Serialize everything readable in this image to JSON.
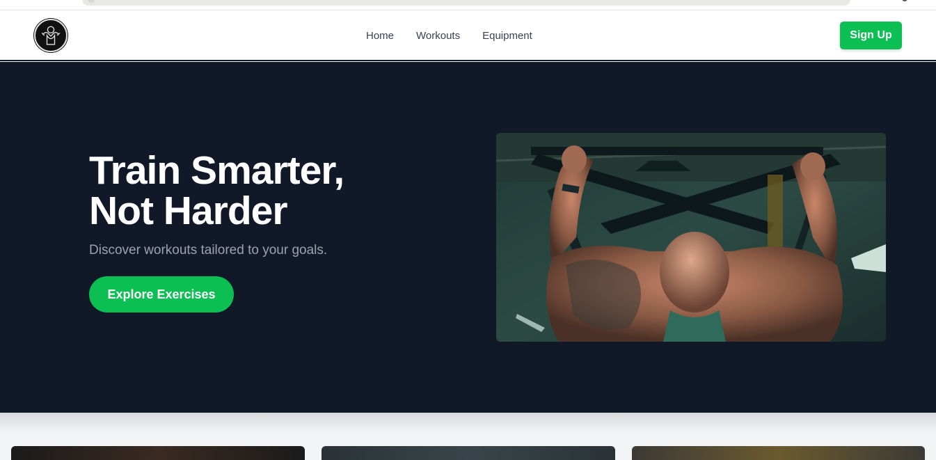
{
  "nav": {
    "links": [
      "Home",
      "Workouts",
      "Equipment"
    ],
    "signup_label": "Sign Up"
  },
  "hero": {
    "title_line1": "Train Smarter,",
    "title_line2": "Not Harder",
    "subtitle": "Discover workouts tailored to your goals.",
    "cta_label": "Explore Exercises"
  },
  "colors": {
    "accent": "#0bbf52",
    "hero_bg": "#111827",
    "subtitle": "#9ca3af"
  },
  "icons": [
    "logo-icon"
  ]
}
